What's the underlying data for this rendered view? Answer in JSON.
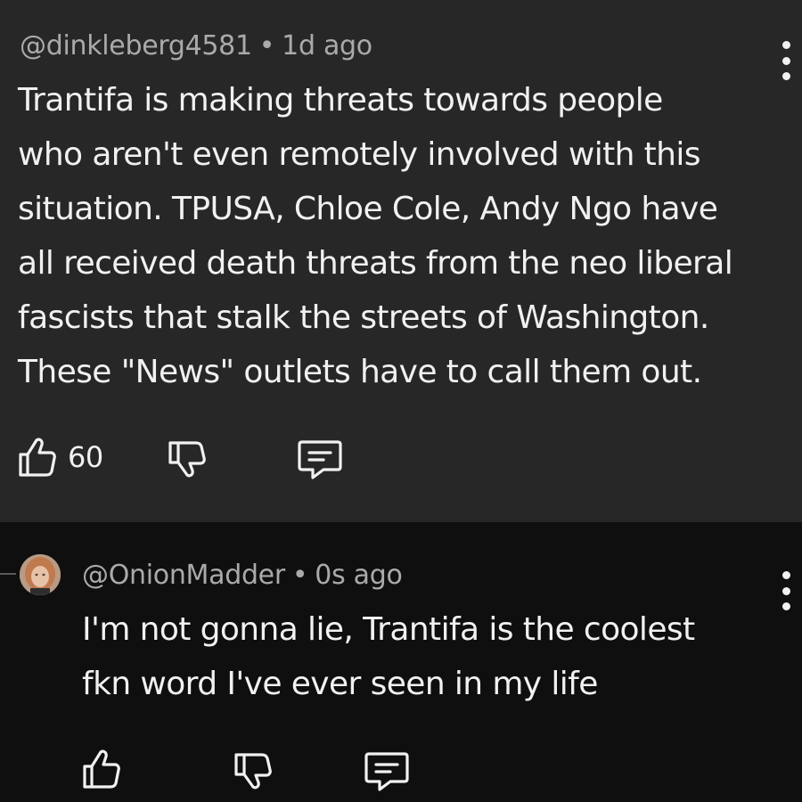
{
  "comment": {
    "author": "@dinkleberg4581",
    "separator": "•",
    "time": "1d ago",
    "lines": [
      "Trantifa is making threats towards people",
      "who aren't even remotely involved with this",
      "situation. TPUSA, Chloe Cole, Andy Ngo have",
      "all received death threats from the neo liberal",
      "fascists that stalk the streets of Washington.",
      "These \"News\" outlets have to call them out."
    ],
    "like_count": "60",
    "icons": [
      "thumbs-up-icon",
      "thumbs-down-icon",
      "reply-icon",
      "more-vert-icon"
    ]
  },
  "reply": {
    "author": "@OnionMadder",
    "separator": "•",
    "time": "0s ago",
    "lines": [
      "I'm not gonna lie, Trantifa is the coolest",
      "fkn word I've ever seen in my life"
    ],
    "icons": [
      "thumbs-up-icon",
      "thumbs-down-icon",
      "reply-icon",
      "more-vert-icon"
    ]
  },
  "colors": {
    "top_background": "#272727",
    "page_background": "#0f0f0f",
    "text": "#f1f1f1",
    "meta_text": "#aaaaaa"
  }
}
